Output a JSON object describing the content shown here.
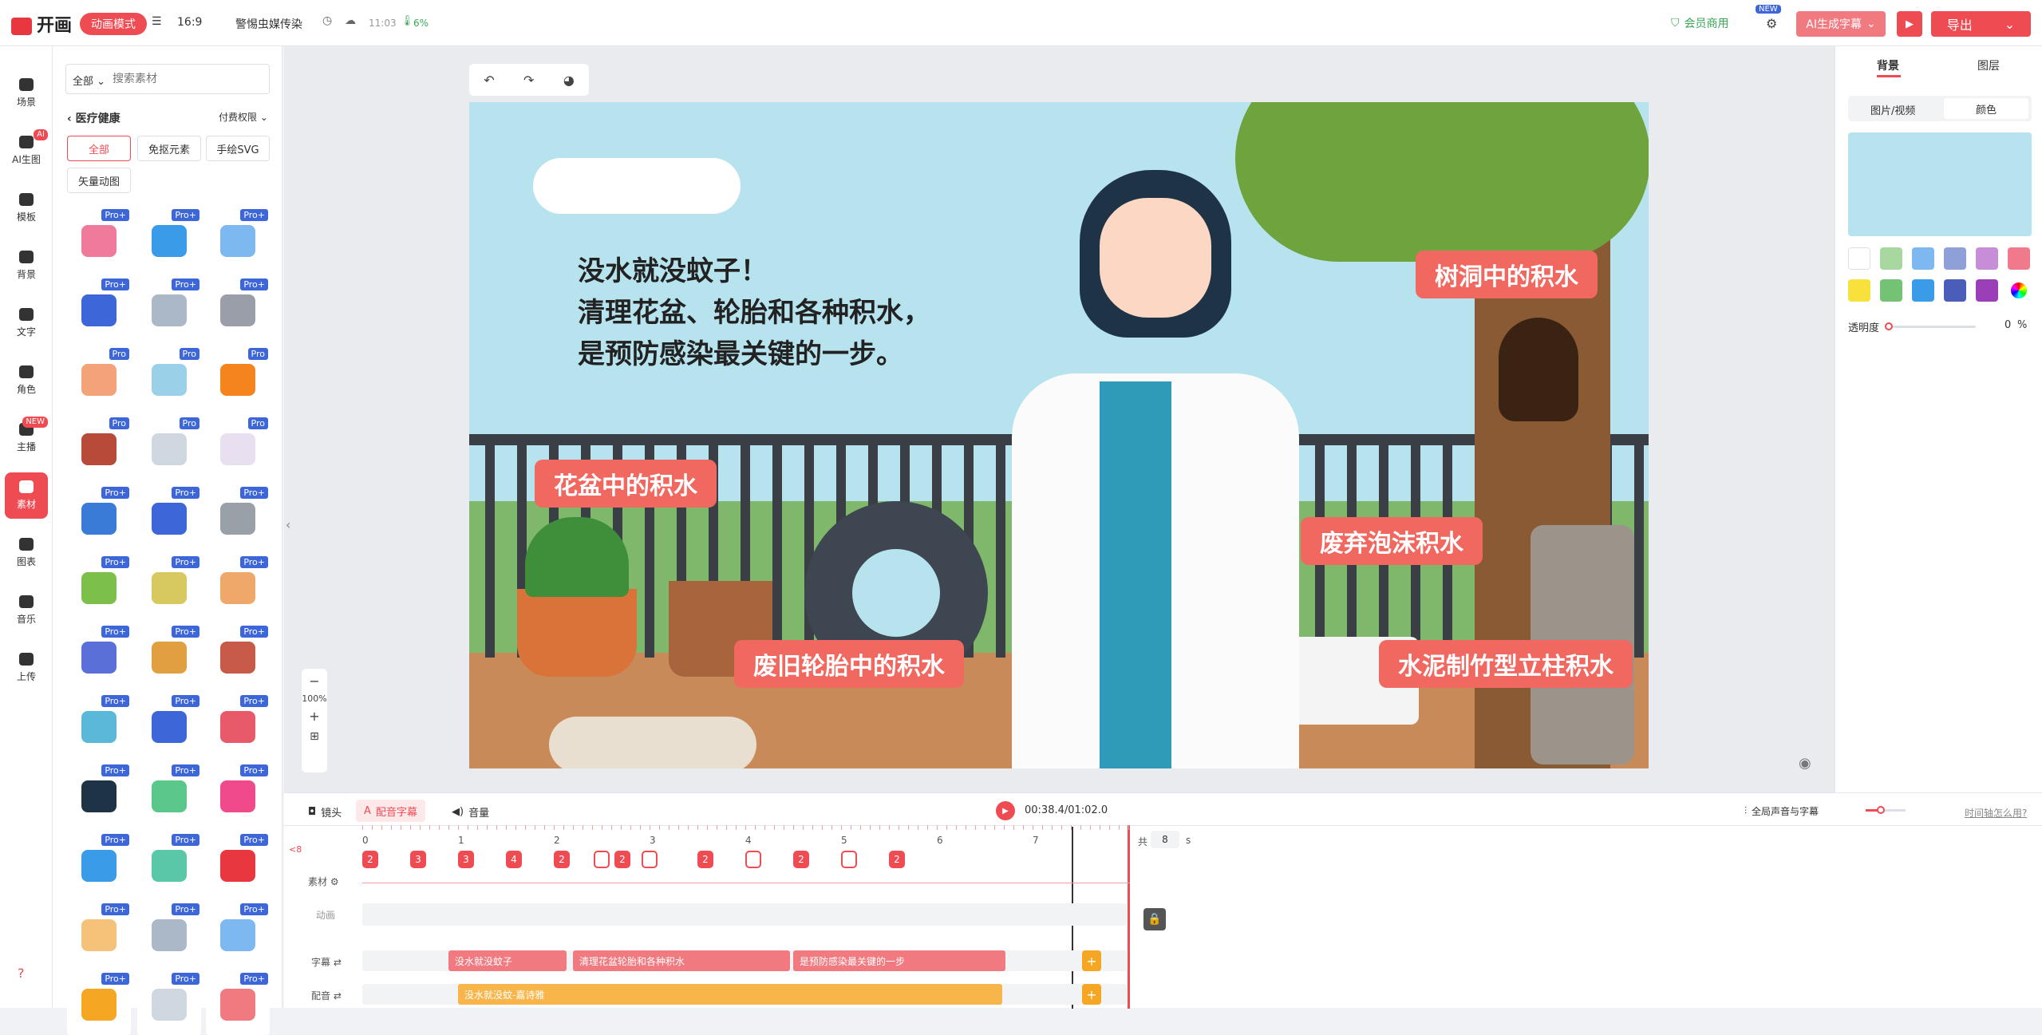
{
  "app": {
    "logo_text": "开画",
    "mode_pill": "动画模式"
  },
  "topbar": {
    "ratio": "16:9",
    "project_title": "警惕虫媒传染",
    "save_time": "11:03",
    "storage_percent": "6%",
    "member_label": "会员商用",
    "new_badge": "NEW",
    "ai_subtitle_label": "AI生成字幕",
    "export_label": "导出"
  },
  "leftnav": {
    "items": [
      {
        "label": "场景"
      },
      {
        "label": "AI生图",
        "badge": "AI"
      },
      {
        "label": "模板"
      },
      {
        "label": "背景"
      },
      {
        "label": "文字"
      },
      {
        "label": "角色"
      },
      {
        "label": "主播",
        "badge": "NEW"
      },
      {
        "label": "素材"
      },
      {
        "label": "图表"
      },
      {
        "label": "音乐"
      },
      {
        "label": "上传"
      }
    ],
    "help": "?"
  },
  "panel": {
    "filter_label": "全部",
    "search_placeholder": "搜索素材",
    "category": "医疗健康",
    "rights_label": "付费权限",
    "chips": [
      "全部",
      "免抠元素",
      "手绘SVG",
      "矢量动图"
    ],
    "pro_label": "Pro",
    "pro_plus_label": "Pro+"
  },
  "canvas": {
    "zoom_percent": "100%",
    "main_text_lines": [
      "没水就没蚊子！",
      "清理花盆、轮胎和各种积水，",
      "是预防感染最关键的一步。"
    ],
    "captions": [
      "花盆中的积水",
      "树洞中的积水",
      "废弃泡沫积水",
      "废旧轮胎中的积水",
      "水泥制竹型立柱积水"
    ],
    "colors": {
      "sky": "#b7e3ee",
      "caption": "#f0685f",
      "ground": "#c98a5a"
    }
  },
  "rightpanel": {
    "tabs": [
      "背景",
      "图层"
    ],
    "subtabs": [
      "图片/视频",
      "颜色"
    ],
    "selected_color": "#b7e3ee",
    "opacity_label": "透明度",
    "opacity_value": "0",
    "opacity_unit": "%",
    "swatches": [
      "#ffffff",
      "#a8d8a0",
      "#7db8f0",
      "#8f9fd8",
      "#c88dd8",
      "#f07a8c",
      "#f7e13a",
      "#74c274",
      "#3a9be8",
      "#4a5db8",
      "#9a3fb8"
    ]
  },
  "timeline": {
    "tabs": [
      "镜头",
      "配音字幕",
      "音量"
    ],
    "time_display": "00:38.4/01:02.0",
    "global_label": "全局声音与字幕",
    "help_link": "时间轴怎么用?",
    "total_label": "共",
    "total_value": "8",
    "total_unit": "s",
    "collapse_label": "<8",
    "ticks": [
      "0",
      "1",
      "2",
      "3",
      "4",
      "5",
      "6",
      "7"
    ],
    "row_labels": {
      "assets": "素材",
      "anim": "动画",
      "subtitle": "字幕",
      "voice": "配音"
    },
    "markers": [
      "2",
      "3",
      "3",
      "4",
      "2",
      "",
      "2",
      "",
      "2",
      "",
      "2",
      "",
      "2"
    ],
    "subtitles": [
      "没水就没蚊子",
      "清理花盆轮胎和各种积水",
      "是预防感染最关键的一步"
    ],
    "voice": "没水就没蚊-嘉诗雅"
  }
}
